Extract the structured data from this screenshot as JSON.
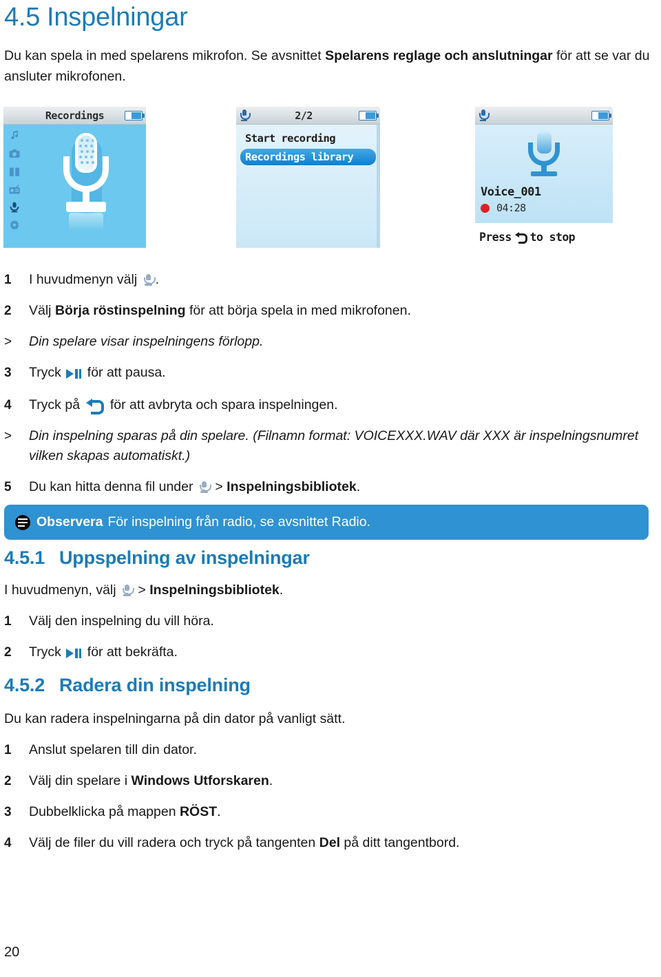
{
  "page": {
    "number": "20",
    "language": "sv"
  },
  "heading": {
    "number": "4.5",
    "title": "Inspelningar",
    "color": "#1b7cb8"
  },
  "intro": {
    "text_before": "Du kan spela in med spelarens mikrofon. Se avsnittet ",
    "bold": "Spelarens reglage och anslutningar",
    "text_after": " för att se var du ansluter mikrofonen."
  },
  "screenshots": [
    {
      "name": "recordings-home-screen",
      "titlebar_title": "Recordings",
      "battery_icon": "battery-icon",
      "sidebar_icons": [
        "music-note-icon",
        "camera-icon",
        "gift-icon",
        "radio-icon",
        "microphone-icon",
        "settings-gear-icon"
      ],
      "main_icon": "large-microphone-icon"
    },
    {
      "name": "recordings-menu-screen",
      "titlebar_icon": "microphone-icon",
      "titlebar_title": "2/2",
      "battery_icon": "battery-icon",
      "menu_items": [
        {
          "label": "Start recording",
          "selected": false
        },
        {
          "label": "Recordings library",
          "selected": true
        }
      ]
    },
    {
      "name": "recording-in-progress-screen",
      "titlebar_icon": "microphone-icon",
      "titlebar_title": "",
      "battery_icon": "battery-icon",
      "main_icon": "microphone-icon",
      "file_name": "Voice_001",
      "record_indicator": "record-dot-icon",
      "elapsed_time": "04:28",
      "footer_before": "Press",
      "footer_icon": "back-arrow-icon",
      "footer_after": "to stop"
    }
  ],
  "steps_main": [
    {
      "marker": "1",
      "parts": [
        {
          "type": "text",
          "value": "I huvudmenyn välj "
        },
        {
          "type": "icon",
          "value": "microphone-icon"
        },
        {
          "type": "text",
          "value": "."
        }
      ]
    },
    {
      "marker": "2",
      "parts": [
        {
          "type": "text",
          "value": "Välj "
        },
        {
          "type": "bold",
          "value": "Börja röstinspelning"
        },
        {
          "type": "text",
          "value": " för att börja spela in med mikrofonen."
        }
      ]
    },
    {
      "marker": ">",
      "note": true,
      "parts": [
        {
          "type": "text",
          "value": "Din spelare visar inspelningens förlopp."
        }
      ]
    },
    {
      "marker": "3",
      "parts": [
        {
          "type": "text",
          "value": "Tryck "
        },
        {
          "type": "icon",
          "value": "play-pause-icon"
        },
        {
          "type": "text",
          "value": " för att pausa."
        }
      ]
    },
    {
      "marker": "4",
      "parts": [
        {
          "type": "text",
          "value": "Tryck på "
        },
        {
          "type": "icon",
          "value": "back-arrow-icon"
        },
        {
          "type": "text",
          "value": " för att avbryta och spara inspelningen."
        }
      ]
    },
    {
      "marker": ">",
      "note": true,
      "parts": [
        {
          "type": "text",
          "value": "Din inspelning sparas på din spelare. (Filnamn format: VOICEXXX.WAV där XXX är inspelningsnumret vilken skapas automatiskt.)"
        }
      ]
    },
    {
      "marker": "5",
      "parts": [
        {
          "type": "text",
          "value": "Du kan hitta denna fil under "
        },
        {
          "type": "icon",
          "value": "microphone-icon"
        },
        {
          "type": "text",
          "value": " > "
        },
        {
          "type": "bold",
          "value": "Inspelningsbibliotek"
        },
        {
          "type": "text",
          "value": "."
        }
      ]
    }
  ],
  "note_box": {
    "icon": "note-icon",
    "label": "Observera",
    "text": "För inspelning från radio, se avsnittet Radio.",
    "background": "#2f92d2"
  },
  "section_451": {
    "number": "4.5.1",
    "title": "Uppspelning av inspelningar",
    "lead_before": "I huvudmenyn, välj ",
    "lead_icon": "microphone-icon",
    "lead_middle": " > ",
    "lead_bold": "Inspelningsbibliotek",
    "lead_after": ".",
    "steps": [
      {
        "marker": "1",
        "parts": [
          {
            "type": "text",
            "value": "Välj den inspelning du vill höra."
          }
        ]
      },
      {
        "marker": "2",
        "parts": [
          {
            "type": "text",
            "value": "Tryck "
          },
          {
            "type": "icon",
            "value": "play-pause-icon"
          },
          {
            "type": "text",
            "value": " för att bekräfta."
          }
        ]
      }
    ]
  },
  "section_452": {
    "number": "4.5.2",
    "title": "Radera din inspelning",
    "lead": "Du kan radera inspelningarna på din dator på vanligt sätt.",
    "steps": [
      {
        "marker": "1",
        "parts": [
          {
            "type": "text",
            "value": "Anslut spelaren till din dator."
          }
        ]
      },
      {
        "marker": "2",
        "parts": [
          {
            "type": "text",
            "value": "Välj din spelare i "
          },
          {
            "type": "bold",
            "value": "Windows Utforskaren"
          },
          {
            "type": "text",
            "value": "."
          }
        ]
      },
      {
        "marker": "3",
        "parts": [
          {
            "type": "text",
            "value": "Dubbelklicka på mappen "
          },
          {
            "type": "bold",
            "value": "RÖST"
          },
          {
            "type": "text",
            "value": "."
          }
        ]
      },
      {
        "marker": "4",
        "parts": [
          {
            "type": "text",
            "value": "Välj de filer du vill radera och tryck på tangenten "
          },
          {
            "type": "bold",
            "value": "Del"
          },
          {
            "type": "text",
            "value": " på ditt tangentbord."
          }
        ]
      }
    ]
  }
}
